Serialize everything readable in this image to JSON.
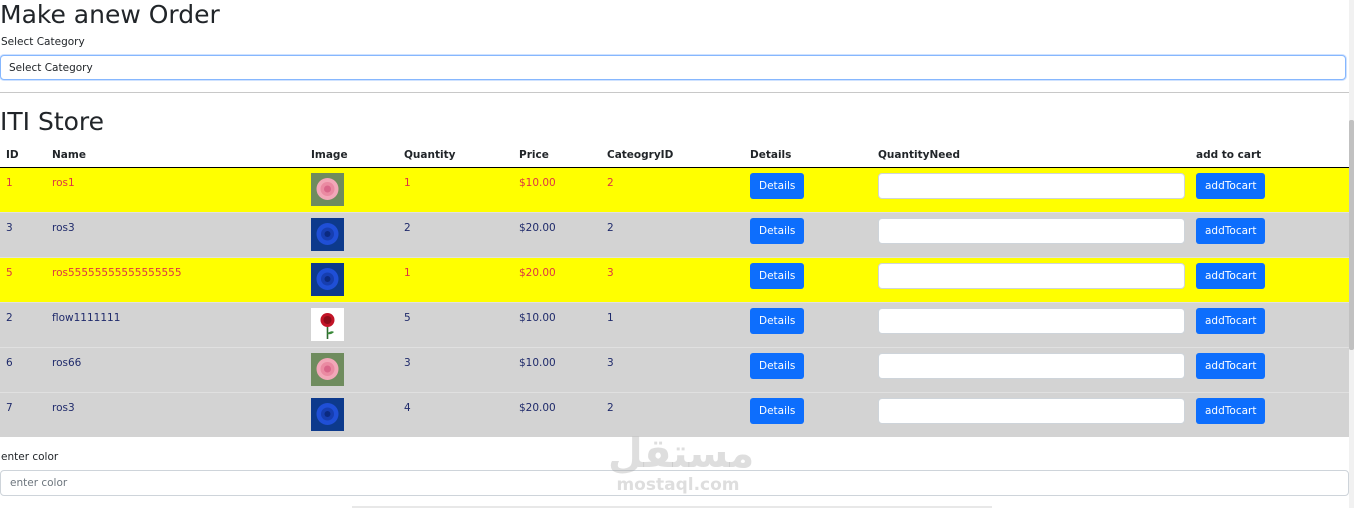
{
  "order": {
    "title": "Make anew Order",
    "category_label": "Select Category",
    "category_selected": "Select Category"
  },
  "store": {
    "title": "ITI Store",
    "columns": [
      "ID",
      "Name",
      "Image",
      "Quantity",
      "Price",
      "CateogryID",
      "Details",
      "QuantityNeed",
      "add to cart"
    ],
    "rows": [
      {
        "id": "1",
        "name": "ros1",
        "image": "pink-rose",
        "quantity": "1",
        "price": "$10.00",
        "category": "2",
        "details": "Details",
        "add": "addTocart",
        "style": "yellow"
      },
      {
        "id": "3",
        "name": "ros3",
        "image": "blue-rose",
        "quantity": "2",
        "price": "$20.00",
        "category": "2",
        "details": "Details",
        "add": "addTocart",
        "style": "gray"
      },
      {
        "id": "5",
        "name": "ros55555555555555555",
        "image": "blue-rose",
        "quantity": "1",
        "price": "$20.00",
        "category": "3",
        "details": "Details",
        "add": "addTocart",
        "style": "yellow"
      },
      {
        "id": "2",
        "name": "flow1111111",
        "image": "red-rose",
        "quantity": "5",
        "price": "$10.00",
        "category": "1",
        "details": "Details",
        "add": "addTocart",
        "style": "gray"
      },
      {
        "id": "6",
        "name": "ros66",
        "image": "pink-rose",
        "quantity": "3",
        "price": "$10.00",
        "category": "3",
        "details": "Details",
        "add": "addTocart",
        "style": "gray"
      },
      {
        "id": "7",
        "name": "ros3",
        "image": "blue-rose",
        "quantity": "4",
        "price": "$20.00",
        "category": "2",
        "details": "Details",
        "add": "addTocart",
        "style": "gray"
      }
    ]
  },
  "color": {
    "label": "enter color",
    "placeholder": "enter color"
  },
  "watermark": {
    "arabic": "مستقل",
    "latin": "mostaql.com"
  },
  "colors": {
    "yellow_row": "#ffff00",
    "gray_row": "#d3d3d3",
    "button": "#0d6efd",
    "yellow_text": "#dc3545",
    "gray_text": "#1f2a6b"
  }
}
